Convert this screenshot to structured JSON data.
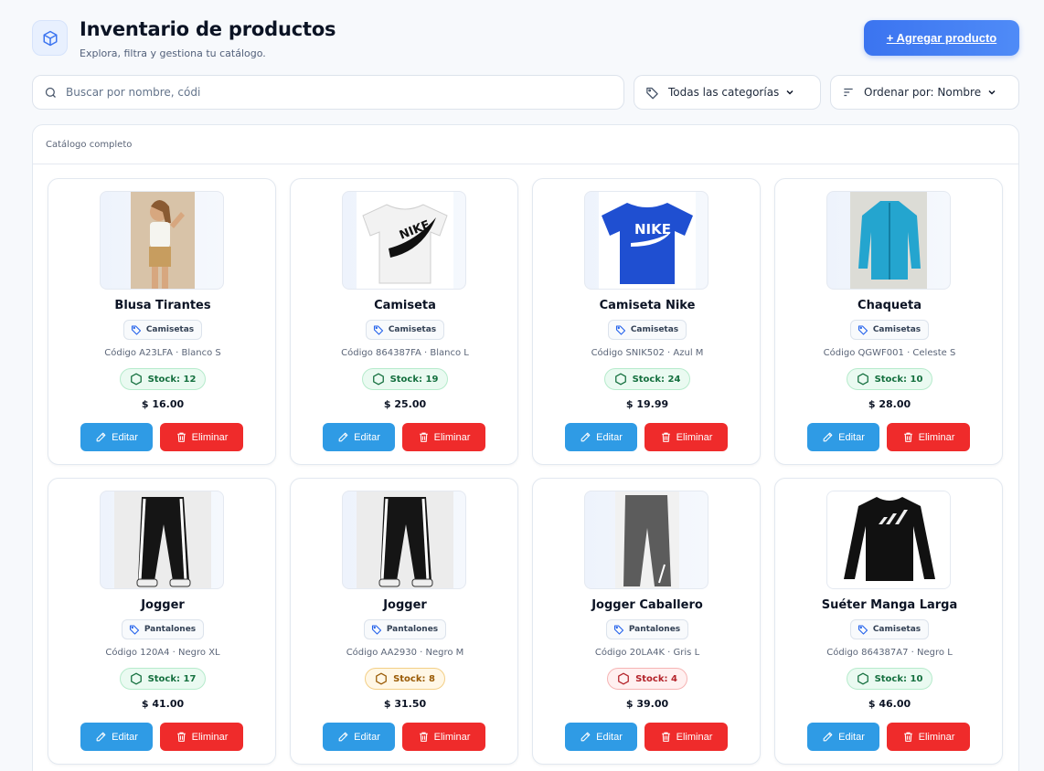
{
  "header": {
    "title": "Inventario de productos",
    "subtitle": "Explora, filtra y gestiona tu catálogo.",
    "add_button": "+ Agregar producto"
  },
  "filters": {
    "search_value": "",
    "search_placeholder": "Buscar por nombre, códi",
    "category": "Todas las categorías",
    "sort": "Ordenar por: Nombre"
  },
  "panel": {
    "title": "Catálogo completo"
  },
  "actions": {
    "edit": "Editar",
    "delete": "Eliminar"
  },
  "colors": {
    "primary": "#3b74f0",
    "edit": "#2f9be5",
    "delete": "#ef2b2b",
    "stock_ok": "#15703f",
    "stock_mid": "#9a5b06",
    "stock_low": "#b4232a"
  },
  "products": [
    {
      "name": "Blusa Tirantes",
      "category": "Camisetas",
      "code": "Código A23LFA · Blanco S",
      "stock": "Stock: 12",
      "stock_level": "ok",
      "price": "$ 16.00",
      "image": "woman-photo"
    },
    {
      "name": "Camiseta",
      "category": "Camisetas",
      "code": "Código 864387FA · Blanco L",
      "stock": "Stock: 19",
      "stock_level": "ok",
      "price": "$ 25.00",
      "image": "white-tshirt"
    },
    {
      "name": "Camiseta Nike",
      "category": "Camisetas",
      "code": "Código SNIK502 · Azul M",
      "stock": "Stock: 24",
      "stock_level": "ok",
      "price": "$ 19.99",
      "image": "blue-tshirt"
    },
    {
      "name": "Chaqueta",
      "category": "Camisetas",
      "code": "Código QGWF001 · Celeste S",
      "stock": "Stock: 10",
      "stock_level": "ok",
      "price": "$ 28.00",
      "image": "blue-jacket"
    },
    {
      "name": "Jogger",
      "category": "Pantalones",
      "code": "Código 120A4 · Negro XL",
      "stock": "Stock: 17",
      "stock_level": "ok",
      "price": "$ 41.00",
      "image": "black-jogger"
    },
    {
      "name": "Jogger",
      "category": "Pantalones",
      "code": "Código AA2930 · Negro M",
      "stock": "Stock: 8",
      "stock_level": "mid",
      "price": "$ 31.50",
      "image": "black-jogger"
    },
    {
      "name": "Jogger Caballero",
      "category": "Pantalones",
      "code": "Código 20LA4K · Gris L",
      "stock": "Stock: 4",
      "stock_level": "low",
      "price": "$ 39.00",
      "image": "grey-jogger"
    },
    {
      "name": "Suéter Manga Larga",
      "category": "Camisetas",
      "code": "Código 864387A7 · Negro L",
      "stock": "Stock: 10",
      "stock_level": "ok",
      "price": "$ 46.00",
      "image": "black-sweater"
    }
  ]
}
